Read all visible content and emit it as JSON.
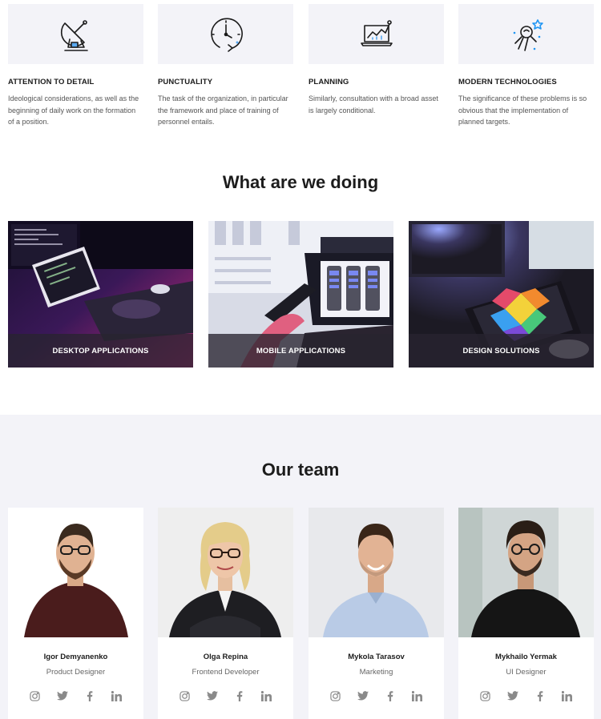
{
  "features": [
    {
      "title": "ATTENTION TO DETAIL",
      "text": "Ideological considerations, as well as the beginning of daily work on the formation of a position.",
      "icon": "satellite-dish-icon"
    },
    {
      "title": "PUNCTUALITY",
      "text": "The task of the organization, in particular the framework and place of training of personnel entails.",
      "icon": "clock-icon"
    },
    {
      "title": "PLANNING",
      "text": "Similarly, consultation with a broad asset is largely conditional.",
      "icon": "laptop-chart-icon"
    },
    {
      "title": "MODERN TECHNOLOGIES",
      "text": "The significance of these problems is so obvious that the implementation of planned targets.",
      "icon": "astronaut-icon"
    }
  ],
  "services_heading": "What are we doing",
  "services": [
    {
      "label": "DESKTOP APPLICATIONS"
    },
    {
      "label": "MOBILE APPLICATIONS"
    },
    {
      "label": "DESIGN SOLUTIONS"
    }
  ],
  "team_heading": "Our team",
  "team": [
    {
      "name": "Igor Demyanenko",
      "role": "Product Designer"
    },
    {
      "name": "Olga Repina",
      "role": "Frontend Developer"
    },
    {
      "name": "Mykola Tarasov",
      "role": "Marketing"
    },
    {
      "name": "Mykhailo Yermak",
      "role": "UI Designer"
    }
  ],
  "social_icons": [
    "instagram-icon",
    "twitter-icon",
    "facebook-icon",
    "linkedin-icon"
  ],
  "colors": {
    "accent": "#2196f3",
    "light_bg": "#f3f3f8",
    "overlay": "#282430"
  }
}
